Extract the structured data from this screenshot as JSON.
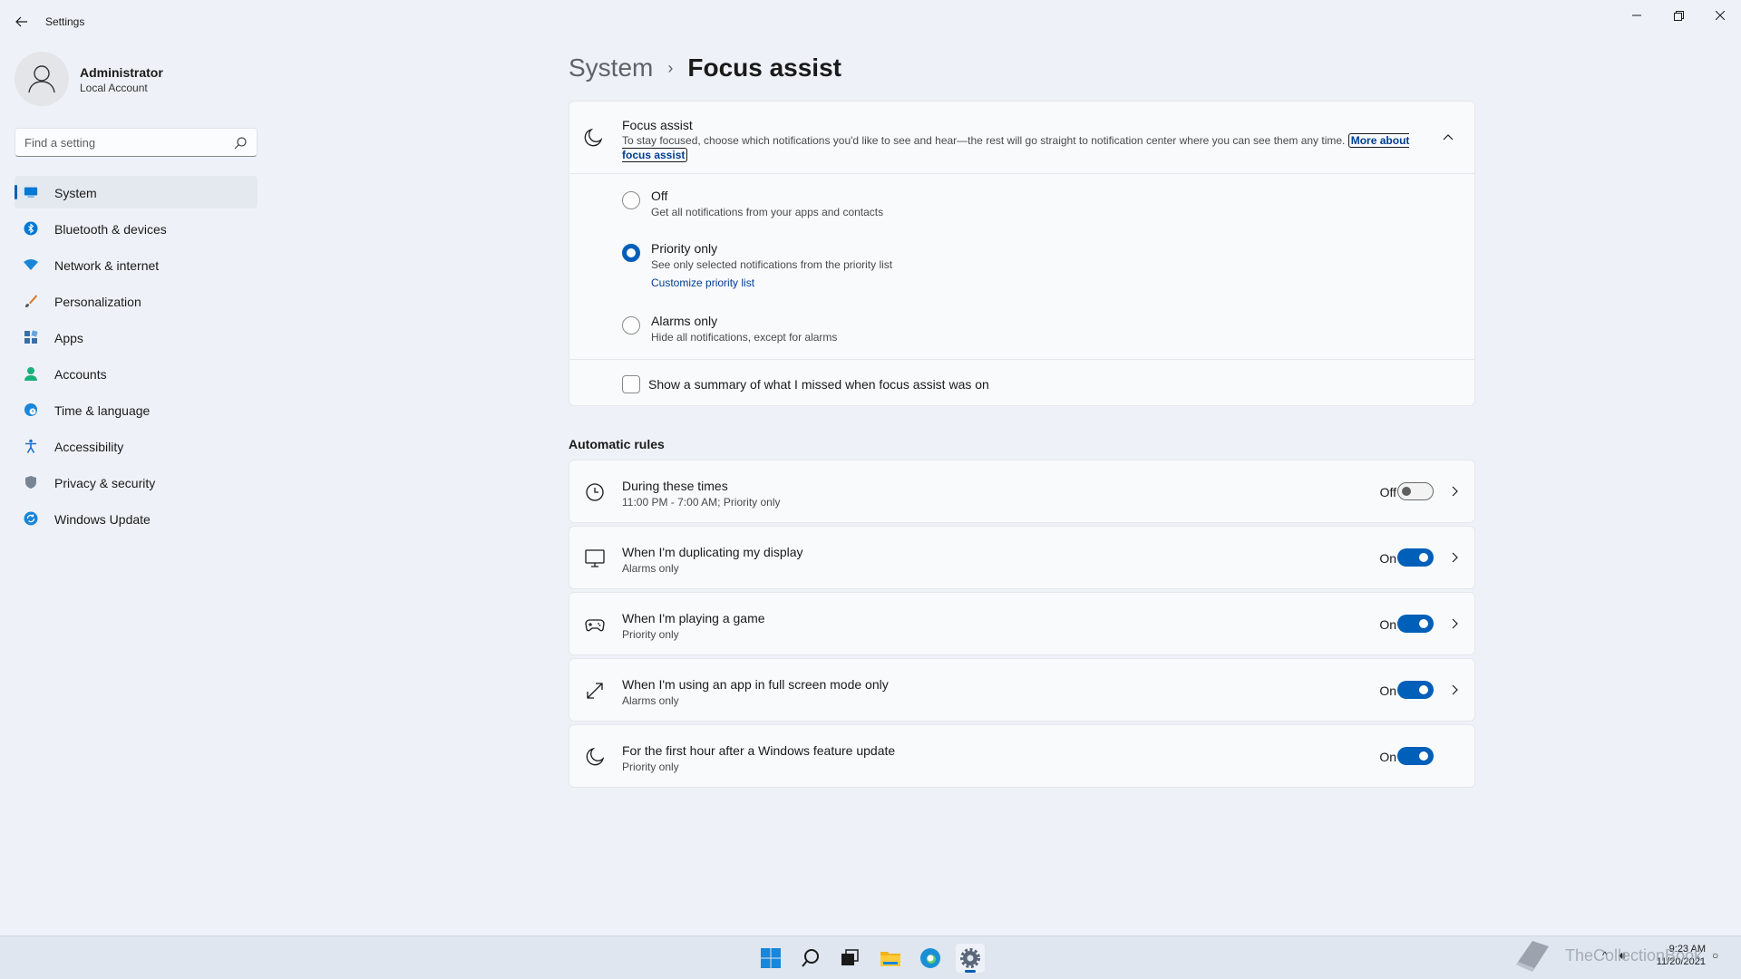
{
  "window": {
    "title": "Settings"
  },
  "profile": {
    "name": "Administrator",
    "account": "Local Account"
  },
  "search": {
    "placeholder": "Find a setting"
  },
  "sidebar": {
    "items": [
      {
        "label": "System",
        "icon": "monitor-icon",
        "selected": true
      },
      {
        "label": "Bluetooth & devices",
        "icon": "bluetooth-icon"
      },
      {
        "label": "Network & internet",
        "icon": "wifi-icon"
      },
      {
        "label": "Personalization",
        "icon": "brush-icon"
      },
      {
        "label": "Apps",
        "icon": "apps-icon"
      },
      {
        "label": "Accounts",
        "icon": "person-icon"
      },
      {
        "label": "Time & language",
        "icon": "globe-clock-icon"
      },
      {
        "label": "Accessibility",
        "icon": "accessibility-icon"
      },
      {
        "label": "Privacy & security",
        "icon": "shield-icon"
      },
      {
        "label": "Windows Update",
        "icon": "update-icon"
      }
    ]
  },
  "breadcrumb": {
    "parent": "System",
    "separator": "›",
    "current": "Focus assist"
  },
  "focus_assist": {
    "title": "Focus assist",
    "description": "To stay focused, choose which notifications you'd like to see and hear—the rest will go straight to notification center where you can see them any time.",
    "link_part1": "More about",
    "link_part2": "focus assist",
    "options": [
      {
        "label": "Off",
        "sub": "Get all notifications from your apps and contacts",
        "checked": false
      },
      {
        "label": "Priority only",
        "sub": "See only selected notifications from the priority list",
        "link": "Customize priority list",
        "checked": true
      },
      {
        "label": "Alarms only",
        "sub": "Hide all notifications, except for alarms",
        "checked": false
      }
    ],
    "summary_label": "Show a summary of what I missed when focus assist was on"
  },
  "automatic_rules": {
    "title": "Automatic rules",
    "rules": [
      {
        "title": "During these times",
        "sub": "11:00 PM - 7:00 AM; Priority only",
        "state": "Off",
        "on": false,
        "icon": "clock-icon",
        "chevron": true
      },
      {
        "title": "When I'm duplicating my display",
        "sub": "Alarms only",
        "state": "On",
        "on": true,
        "icon": "monitor-icon",
        "chevron": true
      },
      {
        "title": "When I'm playing a game",
        "sub": "Priority only",
        "state": "On",
        "on": true,
        "icon": "gamepad-icon",
        "chevron": true
      },
      {
        "title": "When I'm using an app in full screen mode only",
        "sub": "Alarms only",
        "state": "On",
        "on": true,
        "icon": "fullscreen-arrow-icon",
        "chevron": true
      },
      {
        "title": "For the first hour after a Windows feature update",
        "sub": "Priority only",
        "state": "On",
        "on": true,
        "icon": "moon-icon",
        "chevron": false
      }
    ]
  },
  "taskbar": {
    "apps": [
      "start-icon",
      "search-icon",
      "task-view-icon",
      "file-explorer-icon",
      "edge-icon",
      "settings-icon"
    ],
    "time": "9:23 AM",
    "date": "11/20/2021"
  },
  "watermark": "TheCollectionBook",
  "colors": {
    "accent": "#005fb8",
    "background": "#eef2f8",
    "card": "#f9fafc"
  }
}
